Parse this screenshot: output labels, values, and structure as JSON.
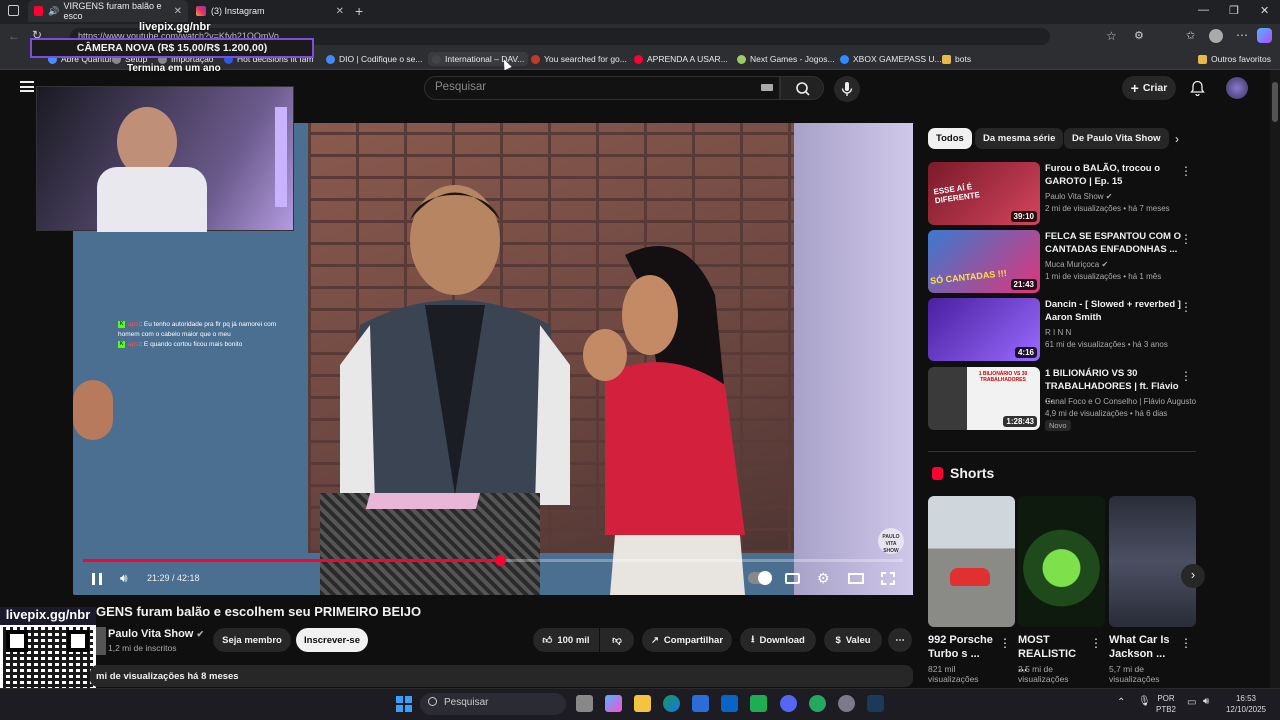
{
  "browser": {
    "tabs": [
      {
        "label": "VIRGENS furam balão e esco",
        "active": true
      },
      {
        "label": "(3) Instagram",
        "active": false
      }
    ],
    "url": "https://www.youtube.com/watch?v=Kfyb21OQmVo",
    "bookmarks": [
      "Abre Quantum",
      "Setup",
      "Importação",
      "Hot decisions fit fam",
      "DIO | Codifique o se...",
      "International – DAV...",
      "You searched for go...",
      "APRENDA A USAR...",
      "Next Games - Jogos...",
      "XBOX GAMEPASS U...",
      "bots"
    ],
    "other_favorites": "Outros favoritos"
  },
  "overlay": {
    "livepix_top": "livepix.gg/nbr",
    "camera_goal": "CÂMERA NOVA (R$ 15,00/R$ 1.200,00)",
    "camera_sub": "Termina em um ano",
    "livepix_bottom": "livepix.gg/nbr",
    "chat": [
      {
        "user": "apst",
        "text": "Eu tenho autoridade pra flr pq já namorei com homem com o cabelo maior que o meu"
      },
      {
        "user": "apst",
        "text": "E quando cortou ficou mais bonito"
      }
    ]
  },
  "youtube": {
    "search_placeholder": "Pesquisar",
    "create_label": "Criar",
    "video": {
      "time": "21:29 / 42:18",
      "progress": 0.508,
      "title": "GENS furam balão e escolhem seu PRIMEIRO BEIJO",
      "channel": "Paulo Vita Show",
      "subscribers": "1,2 mi de inscritos",
      "join_label": "Seja membro",
      "subscribe_label": "Inscrever-se",
      "likes": "100 mil",
      "share_label": "Compartilhar",
      "download_label": "Download",
      "thanks_label": "Valeu",
      "views_line": "mi de visualizações  há 8 meses",
      "watermark": "PAULO VITA SHOW"
    },
    "chips": [
      "Todos",
      "Da mesma série",
      "De Paulo Vita Show"
    ],
    "recommendations": [
      {
        "title": "Furou o BALÃO, trocou o GAROTO | Ep. 15",
        "channel": "Paulo Vita Show",
        "meta": "2 mi de visualizações • há 7 meses",
        "duration": "39:10",
        "thumb_text": "ESSE AÍ É DIFERENTE",
        "color": "#b0283a",
        "verified": true,
        "new": false
      },
      {
        "title": "FELCA SE ESPANTOU COM O CANTADAS ENFADONHAS ...",
        "channel": "Muca Muriçoca",
        "meta": "1 mi de visualizações • há 1 mês",
        "duration": "21:43",
        "thumb_text": "SÓ CANTADAS !!!",
        "color": "#d8397a",
        "verified": true,
        "new": false
      },
      {
        "title": "Dancin - [ Slowed + reverbed ] Aaron Smith",
        "channel": "R I N N",
        "meta": "61 mi de visualizações • há 3 anos",
        "duration": "4:16",
        "thumb_text": "",
        "color": "#6a3bd0",
        "verified": false,
        "new": false
      },
      {
        "title": "1 BILIONÁRIO VS 30 TRABALHADORES | ft. Flávio ...",
        "channel": "Canal Foco e O Conselho | Flávio Augusto",
        "meta": "4,9 mi de visualizações • há 6 dias",
        "duration": "1:28:43",
        "thumb_text": "1 BILIONÁRIO VS 30 TRABALHADORES",
        "color": "#e8e8e8",
        "verified": false,
        "new": true
      }
    ],
    "new_badge": "Novo",
    "shorts_title": "Shorts",
    "shorts": [
      {
        "title": "992 Porsche Turbo s ...",
        "views": "821 mil visualizações",
        "color": "#c9c2b8"
      },
      {
        "title": "MOST REALISTIC ...",
        "views": "2,5 mi de visualizações",
        "color": "#2f7a2a"
      },
      {
        "title": "What Car Is Jackson ...",
        "views": "5,7 mi de visualizações",
        "color": "#3a3d4a"
      }
    ]
  },
  "taskbar": {
    "search_placeholder": "Pesquisar",
    "lang": "POR",
    "layout": "PTB2",
    "time": "16:53",
    "date": "12/10/2025"
  }
}
